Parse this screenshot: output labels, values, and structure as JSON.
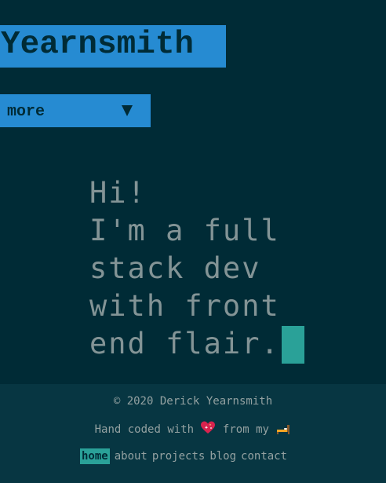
{
  "header": {
    "brand": "Yearnsmith",
    "menu_label": "more",
    "menu_arrow_icon": "triangle-down-icon"
  },
  "hero": {
    "lines": [
      "Hi!",
      "I'm a full",
      "stack dev",
      "with front",
      "end flair."
    ]
  },
  "footer": {
    "copyright": "© 2020 Derick Yearnsmith",
    "handcoded_prefix": "Hand coded with",
    "handcoded_middle": "from my",
    "heart_icon": "sparkling-heart-icon",
    "bed_icon": "bed-icon",
    "nav": [
      "home",
      "about",
      "projects",
      "blog",
      "contact"
    ],
    "active_nav": "home"
  },
  "colors": {
    "background": "#002b36",
    "accent": "#268bd2",
    "cursor": "#2aa198",
    "text": "#839496",
    "footer_bg": "#073642"
  }
}
